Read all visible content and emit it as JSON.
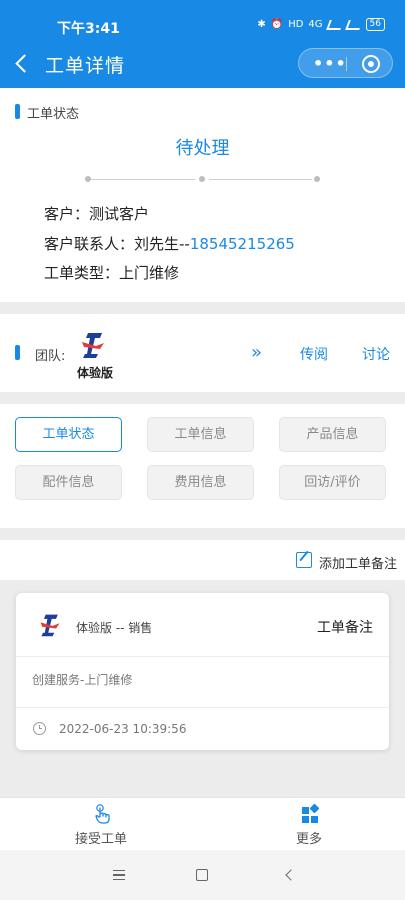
{
  "status_bar": {
    "time": "下午3:41",
    "battery": "56",
    "net1": "HD",
    "net2": "4G"
  },
  "nav": {
    "title": "工单详情",
    "more": "•••"
  },
  "status_section": {
    "label": "工单状态",
    "state": "待处理",
    "customer_label": "客户：",
    "customer": "测试客户",
    "contact_label": "客户联系人：",
    "contact_name": "刘先生--",
    "contact_phone": "18545215265",
    "type_label": "工单类型：",
    "type": "上门维修"
  },
  "team_section": {
    "label": "团队:",
    "team_name": "体验版",
    "forward_label": "传阅",
    "discuss_label": "讨论"
  },
  "tabs": [
    {
      "label": "工单状态",
      "active": true
    },
    {
      "label": "工单信息",
      "active": false
    },
    {
      "label": "产品信息",
      "active": false
    },
    {
      "label": "配件信息",
      "active": false
    },
    {
      "label": "费用信息",
      "active": false
    },
    {
      "label": "回访/评价",
      "active": false
    }
  ],
  "add_note": {
    "label": "添加工单备注"
  },
  "note": {
    "author": "体验版 -- 销售",
    "title": "工单备注",
    "body": "创建服务-上门维修",
    "time": "2022-06-23 10:39:56"
  },
  "bottom_bar": {
    "accept_label": "接受工单",
    "more_label": "更多"
  },
  "colors": {
    "primary": "#1989e6",
    "background": "#ececec"
  }
}
